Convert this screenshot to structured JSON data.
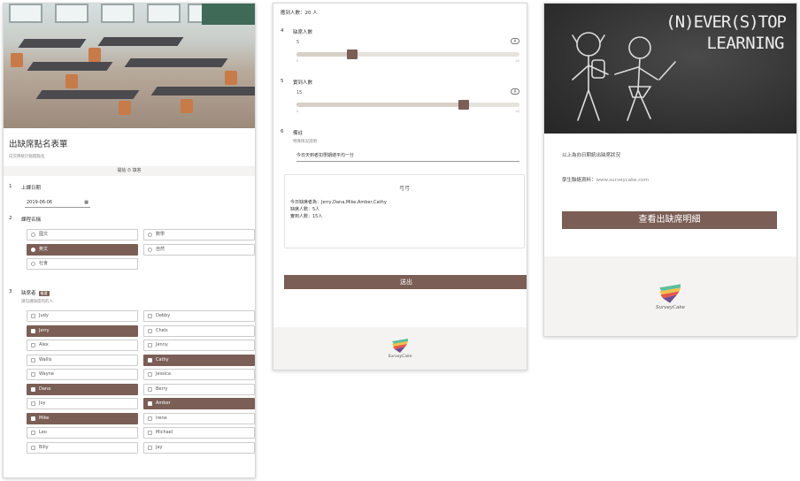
{
  "form": {
    "title": "出缺席點名表單",
    "subtitle": "向交際統計點開點名",
    "lang_label": "開始 ⏱ 填答",
    "q1": {
      "num": "1",
      "label": "上課日期",
      "value": "2019-06-06"
    },
    "q2": {
      "num": "2",
      "label": "課程名稱",
      "options": [
        "國文",
        "數學",
        "英文",
        "自然",
        "社會"
      ],
      "selected": "英文"
    },
    "q3": {
      "num": "3",
      "label": "缺席者",
      "tag": "複選",
      "hint": "請勾選缺席的的人",
      "options": [
        "Judy",
        "Debby",
        "Jerry",
        "Chels",
        "Alex",
        "Jenny",
        "Wallis",
        "Cathy",
        "Wayne",
        "Jessica",
        "Dana",
        "Berry",
        "Joy",
        "Amber",
        "Mike",
        "Irene",
        "Leo",
        "Michael",
        "Billy",
        "Jay"
      ],
      "selected": [
        "Jerry",
        "Cathy",
        "Dana",
        "Amber",
        "Mike"
      ]
    }
  },
  "page2": {
    "stat": "應到人數：20 人",
    "q4": {
      "num": "4",
      "label": "缺席人數",
      "value": "5",
      "min": "0",
      "max": "20",
      "fraction": 0.25
    },
    "q5": {
      "num": "5",
      "label": "實到人數",
      "value": "15",
      "min": "0",
      "max": "20",
      "fraction": 0.75
    },
    "q6": {
      "num": "6",
      "label": "備註",
      "hint": "特殊情況說明",
      "value": "今日天到者扣學期總平均一分"
    },
    "summary": {
      "heading": "弓弓",
      "line1": "今日缺席者為：Jerry,Dana,Mike,Amber,Cathy",
      "line2": "缺席人數：5人",
      "line3": "實到人數：15人"
    },
    "submit": "送出",
    "brand": "SurveyCake"
  },
  "page3": {
    "chalk_line1": "(N)EVER(S)TOP",
    "chalk_line2": "LEARNING",
    "line1": "以上為向日期統出缺席狀況",
    "contact_label": "學生聯絡資料：",
    "contact_value": "www.surveycake.com",
    "button": "查看出缺席明細",
    "brand": "SurveyCake"
  }
}
